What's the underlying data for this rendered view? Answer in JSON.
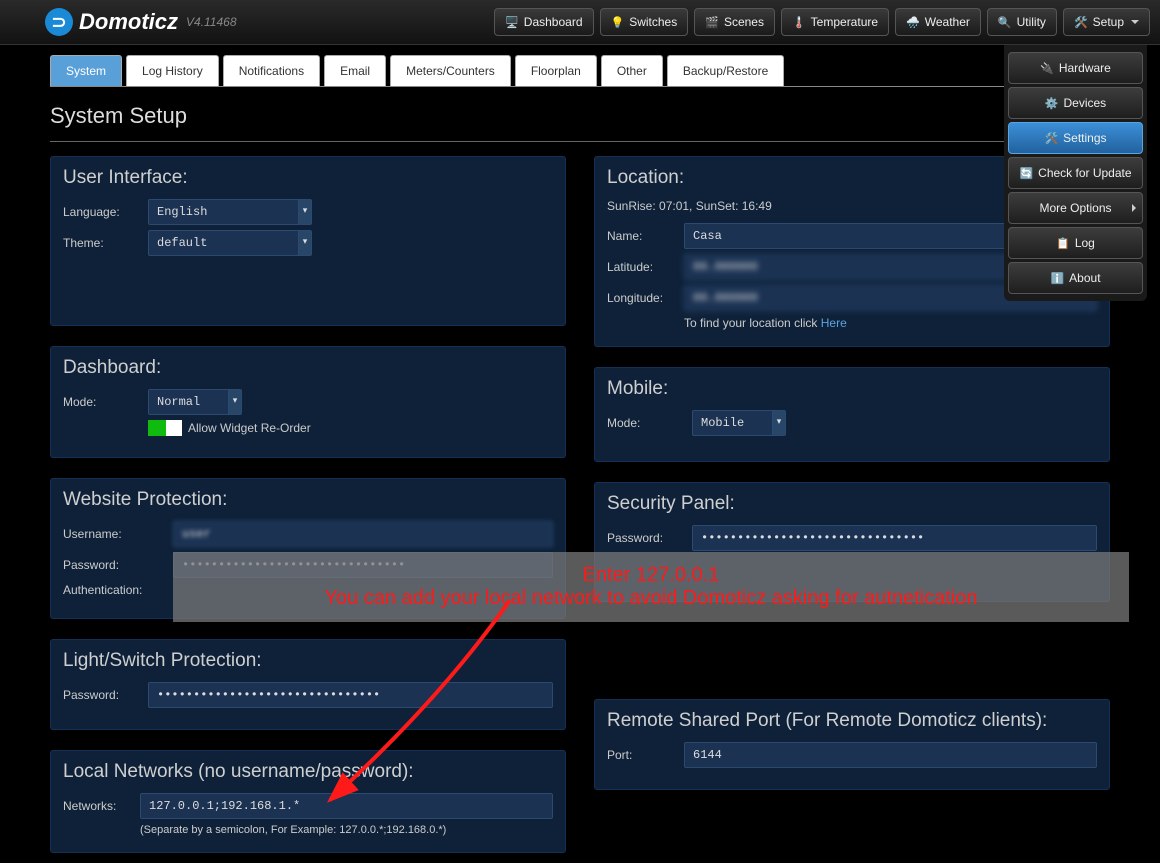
{
  "app": {
    "name": "Domoticz",
    "version": "V4.11468"
  },
  "topnav": {
    "dashboard": "Dashboard",
    "switches": "Switches",
    "scenes": "Scenes",
    "temperature": "Temperature",
    "weather": "Weather",
    "utility": "Utility",
    "setup": "Setup"
  },
  "setup_menu": {
    "hardware": "Hardware",
    "devices": "Devices",
    "settings": "Settings",
    "check_update": "Check for Update",
    "more_options": "More Options",
    "log": "Log",
    "about": "About"
  },
  "tabs": {
    "system": "System",
    "log_history": "Log History",
    "notifications": "Notifications",
    "email": "Email",
    "meters": "Meters/Counters",
    "floorplan": "Floorplan",
    "other": "Other",
    "backup": "Backup/Restore"
  },
  "page_title": "System Setup",
  "ui": {
    "heading": "User Interface:",
    "language_label": "Language:",
    "language_value": "English",
    "theme_label": "Theme:",
    "theme_value": "default"
  },
  "location": {
    "heading": "Location:",
    "sunrise": "SunRise: 07:01, SunSet: 16:49",
    "name_label": "Name:",
    "name_value": "Casa",
    "lat_label": "Latitude:",
    "lon_label": "Longitude:",
    "hint": "To find your location click ",
    "here": "Here"
  },
  "dashboard": {
    "heading": "Dashboard:",
    "mode_label": "Mode:",
    "mode_value": "Normal",
    "reorder": "Allow Widget Re-Order"
  },
  "mobile": {
    "heading": "Mobile:",
    "mode_label": "Mode:",
    "mode_value": "Mobile"
  },
  "website_prot": {
    "heading": "Website Protection:",
    "user_label": "Username:",
    "pass_label": "Password:",
    "auth_label": "Authentication:"
  },
  "security_panel": {
    "heading": "Security Panel:",
    "pass_label": "Password:"
  },
  "light_prot": {
    "heading": "Light/Switch Protection:",
    "pass_label": "Password:"
  },
  "local_net": {
    "heading": "Local Networks (no username/password):",
    "net_label": "Networks:",
    "net_value": "127.0.0.1;192.168.1.*",
    "hint": "(Separate by a semicolon, For Example: 127.0.0.*;192.168.0.*)"
  },
  "remote": {
    "heading": "Remote Shared Port (For Remote Domoticz clients):",
    "port_label": "Port:",
    "port_value": "6144"
  },
  "annotation": {
    "line1": "Enter 127.0.0.1",
    "line2": "You can add your local network to avoid Domoticz asking for autnetication"
  }
}
